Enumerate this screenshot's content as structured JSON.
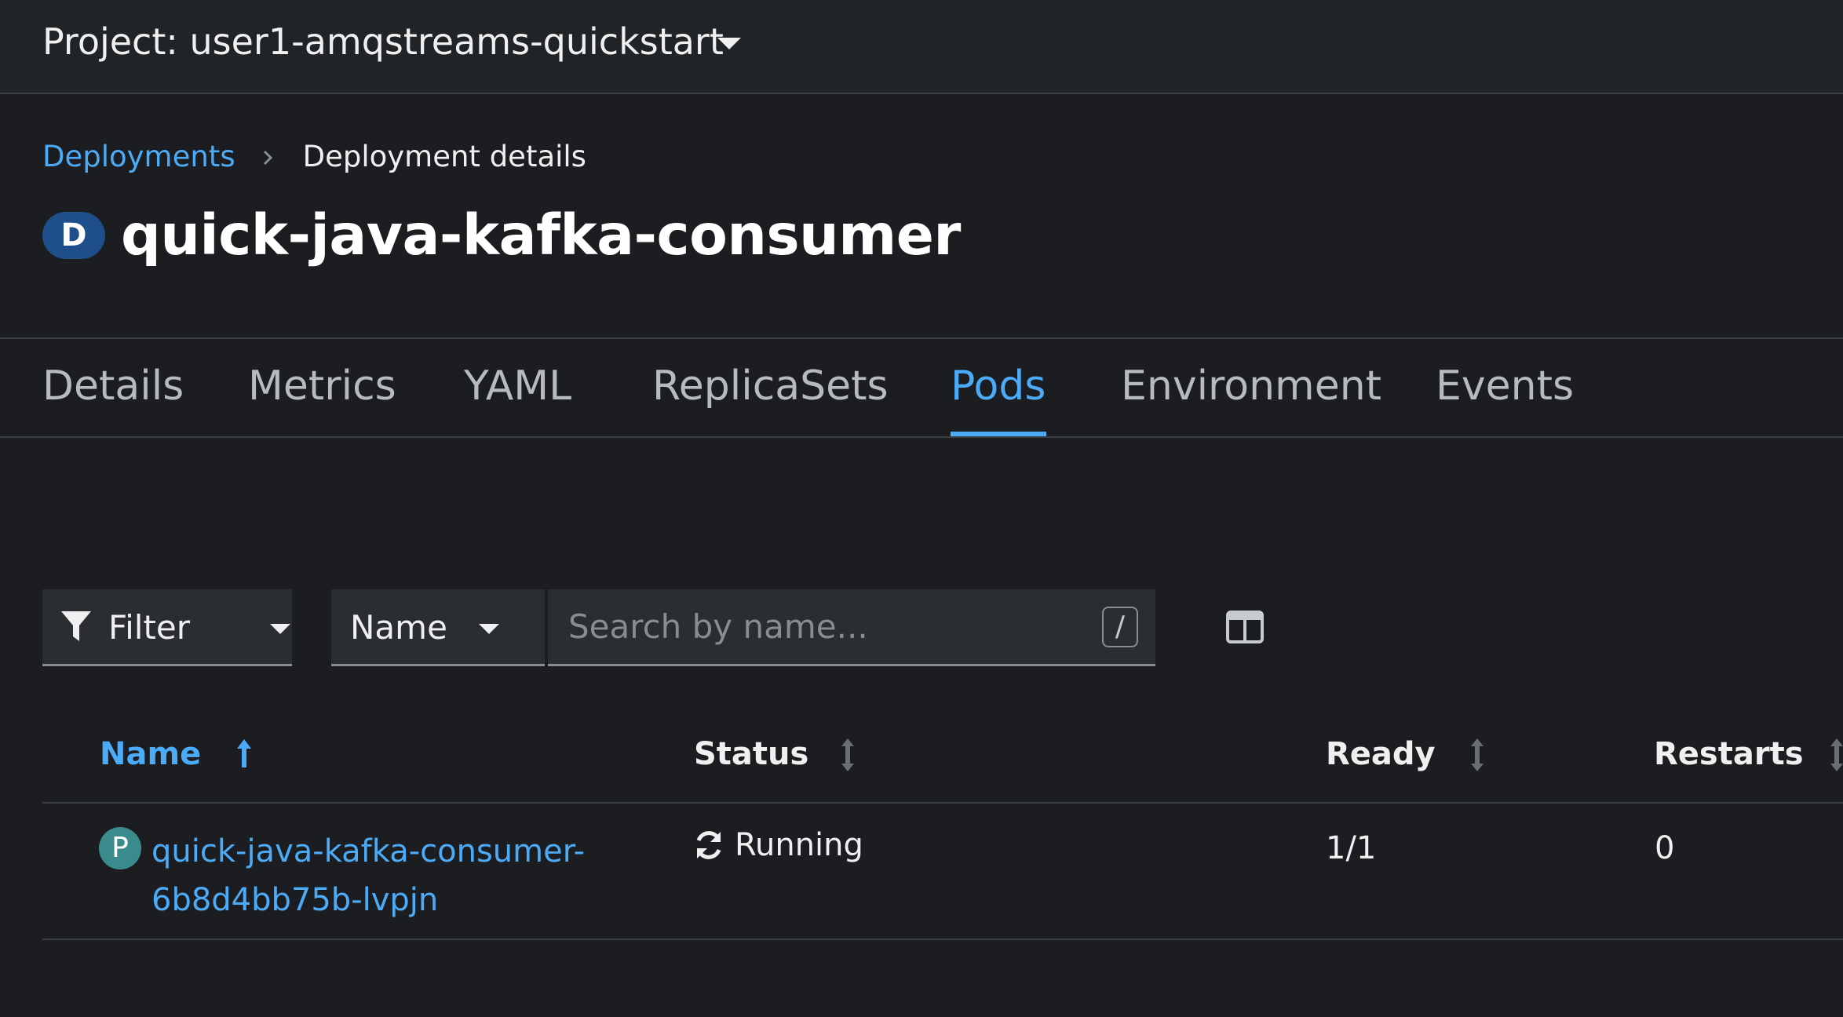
{
  "project_bar": {
    "label": "Project: user1-amqstreams-quickstart"
  },
  "breadcrumb": {
    "parent": "Deployments",
    "current": "Deployment details"
  },
  "header": {
    "badge": "D",
    "title": "quick-java-kafka-consumer"
  },
  "tabs": [
    {
      "label": "Details"
    },
    {
      "label": "Metrics"
    },
    {
      "label": "YAML"
    },
    {
      "label": "ReplicaSets"
    },
    {
      "label": "Pods"
    },
    {
      "label": "Environment"
    },
    {
      "label": "Events"
    }
  ],
  "active_tab": "Pods",
  "toolbar": {
    "filter_label": "Filter",
    "attribute_select": "Name",
    "search_placeholder": "Search by name...",
    "search_value": "",
    "shortcut_hint": "/"
  },
  "table": {
    "columns": [
      "Name",
      "Status",
      "Ready",
      "Restarts"
    ],
    "sorted_column": "Name",
    "rows": [
      {
        "badge": "P",
        "name": "quick-java-kafka-consumer-6b8d4bb75b-lvpjn",
        "status": "Running",
        "ready": "1/1",
        "restarts": "0"
      }
    ]
  },
  "colors": {
    "background": "#1b1d21",
    "accent": "#4cabf7",
    "deployment_badge": "#1e4f8a",
    "pod_badge": "#3a8c8c"
  }
}
